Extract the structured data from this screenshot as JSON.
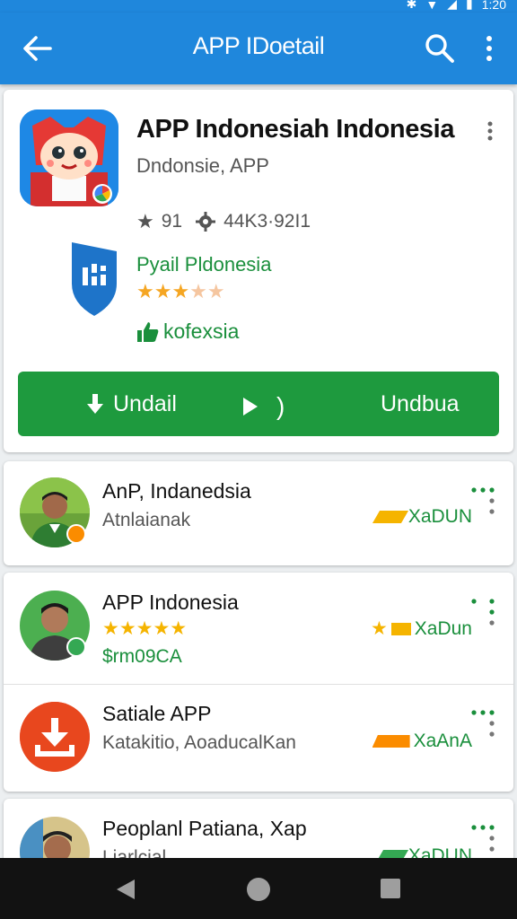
{
  "status_bar": {
    "icons": [
      "bluetooth-icon",
      "wifi-icon",
      "signal-icon",
      "battery-icon"
    ],
    "time": "1:20"
  },
  "app_bar": {
    "title": "APP IDoetail",
    "color": "#1f87dc"
  },
  "hero": {
    "app_name": "APP Indonesiah Indonesia",
    "publisher": "Dndonsie, APP",
    "rating_value": "91",
    "size_value": "44K3·92I1",
    "sub_title": "Pyail Pldonesia",
    "stars": "★★★★★",
    "rating_fraction": 0.6,
    "like_label": "kofexsia",
    "download": {
      "left_label": "Undail",
      "right_label": "Undbua",
      "color": "#1e9a3e"
    }
  },
  "list": [
    {
      "title": "AnP, Indanedsia",
      "subtitle": "Atnlaianak",
      "tag": "XaDUN"
    },
    {
      "title": "APP Indonesia",
      "stars": "★★★★★",
      "price": "$rm09CA",
      "tag": "XaDun"
    },
    {
      "title": "Satiale APP",
      "subtitle": "Katakitio, AoaducalKan",
      "tag": "XaAnA"
    },
    {
      "title": "Peoplanl Patiana, Xap",
      "subtitle": "Liarlcial",
      "tag": "XaDUN"
    }
  ]
}
